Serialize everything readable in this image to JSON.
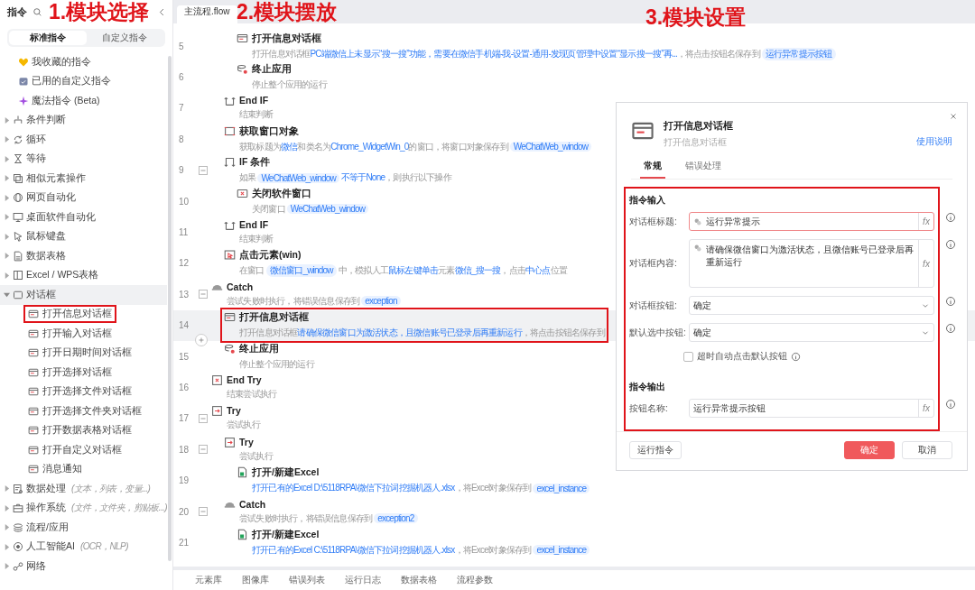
{
  "annotations": [
    {
      "text": "1.模块选择"
    },
    {
      "text": "2.模块摆放"
    },
    {
      "text": "3.模块设置"
    }
  ],
  "sidebar": {
    "title": "指令",
    "tabs": [
      {
        "label": "标准指令",
        "selected": true
      },
      {
        "label": "自定义指令",
        "selected": false
      }
    ],
    "items": [
      {
        "kind": "shortcut",
        "label": "我收藏的指令"
      },
      {
        "kind": "shortcut",
        "label": "已用的自定义指令"
      },
      {
        "kind": "shortcut",
        "label": "魔法指令 (Beta)"
      },
      {
        "kind": "category",
        "label": "条件判断",
        "expanded": false
      },
      {
        "kind": "category",
        "label": "循环",
        "expanded": false
      },
      {
        "kind": "category",
        "label": "等待",
        "expanded": false
      },
      {
        "kind": "category",
        "label": "相似元素操作",
        "expanded": false
      },
      {
        "kind": "category",
        "label": "网页自动化",
        "expanded": false
      },
      {
        "kind": "category",
        "label": "桌面软件自动化",
        "expanded": false
      },
      {
        "kind": "category",
        "label": "鼠标键盘",
        "expanded": false
      },
      {
        "kind": "category",
        "label": "数据表格",
        "expanded": false
      },
      {
        "kind": "category",
        "label": "Excel / WPS表格",
        "expanded": false
      },
      {
        "kind": "category",
        "label": "对话框",
        "expanded": true,
        "children": [
          {
            "label": "打开信息对话框",
            "highlighted": true
          },
          {
            "label": "打开输入对话框",
            "highlighted": false
          },
          {
            "label": "打开日期时间对话框",
            "highlighted": false
          },
          {
            "label": "打开选择对话框",
            "highlighted": false
          },
          {
            "label": "打开选择文件对话框",
            "highlighted": false
          },
          {
            "label": "打开选择文件夹对话框",
            "highlighted": false
          },
          {
            "label": "打开数据表格对话框",
            "highlighted": false
          },
          {
            "label": "打开自定义对话框",
            "highlighted": false
          },
          {
            "label": "消息通知",
            "highlighted": false
          }
        ]
      },
      {
        "kind": "category",
        "label": "数据处理",
        "hint": "(文本，列表，变量...)",
        "expanded": false
      },
      {
        "kind": "category",
        "label": "操作系统",
        "hint": "(文件，文件夹，剪贴板...)",
        "expanded": false
      },
      {
        "kind": "category",
        "label": "流程/应用",
        "expanded": false
      },
      {
        "kind": "category",
        "label": "人工智能AI",
        "hint": "(OCR，NLP)",
        "expanded": false
      },
      {
        "kind": "category",
        "label": "网络",
        "expanded": false
      }
    ]
  },
  "editor": {
    "tab": "主流程.flow"
  },
  "flow": {
    "items": [
      {
        "children": [
          {
            "children": [
              {
                "line": "5",
                "kind": "dialog",
                "title": "打开信息对话框",
                "selected": false,
                "highlighted": false,
                "desc": [
                  {
                    "kind": "text",
                    "text": "打开信息对话框"
                  },
                  {
                    "kind": "link",
                    "text": "PC端微信上未显示“搜一搜”功能，需要在微信手机端-我-设置-通用-发现页管理中设置“显示搜一搜”再..."
                  },
                  {
                    "kind": "text",
                    "text": "，将点击按钮名保存到"
                  },
                  {
                    "kind": "chip",
                    "text": "运行异常提示按钮"
                  }
                ]
              },
              {
                "line": "6",
                "kind": "stop",
                "title": "终止应用",
                "selected": false,
                "highlighted": false,
                "desc": [
                  {
                    "kind": "text",
                    "text": "停止整个应用的运行"
                  }
                ]
              }
            ]
          },
          {
            "line": "7",
            "kind": "endif",
            "title": "End IF",
            "selected": false,
            "highlighted": false,
            "desc": [
              {
                "kind": "text",
                "text": "结束判断"
              }
            ]
          },
          {
            "line": "8",
            "kind": "window",
            "title": "获取窗口对象",
            "selected": false,
            "highlighted": false,
            "desc": [
              {
                "kind": "text",
                "text": "获取标题为"
              },
              {
                "kind": "link",
                "text": "微信"
              },
              {
                "kind": "text",
                "text": "和类名为"
              },
              {
                "kind": "link",
                "text": "Chrome_WidgetWin_0"
              },
              {
                "kind": "text",
                "text": "的窗口，将窗口对象保存到"
              },
              {
                "kind": "chip",
                "text": "WeChatWeb_window"
              }
            ]
          },
          {
            "line": "9",
            "kind": "if",
            "title": "IF 条件",
            "selected": false,
            "highlighted": false,
            "expanded": true,
            "desc": [
              {
                "kind": "text",
                "text": "如果"
              },
              {
                "kind": "chip",
                "text": "WeChatWeb_window"
              },
              {
                "kind": "link",
                "text": "不等于None"
              },
              {
                "kind": "text",
                "text": "，则执行以下操作"
              }
            ],
            "children": [
              {
                "line": "10",
                "kind": "close-window",
                "title": "关闭软件窗口",
                "selected": false,
                "highlighted": false,
                "desc": [
                  {
                    "kind": "text",
                    "text": "关闭窗口"
                  },
                  {
                    "kind": "chip",
                    "text": "WeChatWeb_window"
                  }
                ]
              }
            ]
          },
          {
            "line": "11",
            "kind": "endif",
            "title": "End IF",
            "selected": false,
            "highlighted": false,
            "desc": [
              {
                "kind": "text",
                "text": "结束判断"
              }
            ]
          },
          {
            "line": "12",
            "kind": "click",
            "title": "点击元素(win)",
            "selected": false,
            "highlighted": false,
            "desc": [
              {
                "kind": "text",
                "text": "在窗口"
              },
              {
                "kind": "chip",
                "text": "微信窗口_window"
              },
              {
                "kind": "text",
                "text": "中，模拟人工"
              },
              {
                "kind": "link",
                "text": "鼠标左键单击"
              },
              {
                "kind": "text",
                "text": "元素"
              },
              {
                "kind": "link",
                "text": "微信_搜一搜"
              },
              {
                "kind": "text",
                "text": "，点击"
              },
              {
                "kind": "link",
                "text": "中心点"
              },
              {
                "kind": "text",
                "text": "位置"
              }
            ]
          }
        ]
      },
      {
        "line": "13",
        "kind": "catch",
        "title": "Catch",
        "selected": false,
        "highlighted": false,
        "expanded": true,
        "desc": [
          {
            "kind": "text",
            "text": "尝试失败时执行，将错误信息保存到"
          },
          {
            "kind": "chip",
            "text": "exception"
          }
        ],
        "children": [
          {
            "line": "14",
            "kind": "dialog",
            "title": "打开信息对话框",
            "selected": true,
            "highlighted": true,
            "desc": [
              {
                "kind": "text",
                "text": "打开信息对话框"
              },
              {
                "kind": "link",
                "text": "请确保微信窗口为激活状态，且微信账号已登录后再重新运行"
              },
              {
                "kind": "text",
                "text": "，将点击按钮名保存到"
              }
            ]
          },
          {
            "line": "15",
            "kind": "stop",
            "title": "终止应用",
            "selected": false,
            "highlighted": false,
            "desc": [
              {
                "kind": "text",
                "text": "停止整个应用的运行"
              }
            ]
          }
        ]
      },
      {
        "line": "16",
        "kind": "endtry",
        "title": "End Try",
        "selected": false,
        "highlighted": false,
        "desc": [
          {
            "kind": "text",
            "text": "结束尝试执行"
          }
        ]
      },
      {
        "line": "17",
        "kind": "try",
        "title": "Try",
        "selected": false,
        "highlighted": false,
        "expanded": true,
        "desc": [
          {
            "kind": "text",
            "text": "尝试执行"
          }
        ],
        "children": [
          {
            "line": "18",
            "kind": "try",
            "title": "Try",
            "selected": false,
            "highlighted": false,
            "expanded": true,
            "desc": [
              {
                "kind": "text",
                "text": "尝试执行"
              }
            ],
            "children": [
              {
                "line": "19",
                "kind": "excel",
                "title": "打开/新建Excel",
                "selected": false,
                "highlighted": false,
                "desc": [
                  {
                    "kind": "link",
                    "text": "打开已有的Excel D:\\5118RPA\\微信下拉词挖掘机器人.xlsx"
                  },
                  {
                    "kind": "text",
                    "text": "，将Excel对象保存到"
                  },
                  {
                    "kind": "chip",
                    "text": "excel_instance"
                  }
                ]
              }
            ]
          },
          {
            "line": "20",
            "kind": "catch",
            "title": "Catch",
            "selected": false,
            "highlighted": false,
            "expanded": true,
            "desc": [
              {
                "kind": "text",
                "text": "尝试失败时执行，将错误信息保存到"
              },
              {
                "kind": "chip",
                "text": "exception2"
              }
            ],
            "children": [
              {
                "line": "21",
                "kind": "excel",
                "title": "打开/新建Excel",
                "selected": false,
                "highlighted": false,
                "desc": [
                  {
                    "kind": "link",
                    "text": "打开已有的Excel C:\\5118RPA\\微信下拉词挖掘机器人.xlsx"
                  },
                  {
                    "kind": "text",
                    "text": "，将Excel对象保存到"
                  },
                  {
                    "kind": "chip",
                    "text": "excel_instance"
                  }
                ]
              }
            ]
          }
        ]
      }
    ]
  },
  "bottom_tabs": [
    "元素库",
    "图像库",
    "错误列表",
    "运行日志",
    "数据表格",
    "流程参数"
  ],
  "dialog": {
    "title": "打开信息对话框",
    "subtitle": "打开信息对话框",
    "help_link": "使用说明",
    "highlighted": true,
    "tabs": [
      {
        "label": "常规",
        "selected": true
      },
      {
        "label": "错误处理",
        "selected": false
      }
    ],
    "sections": [
      {
        "title": "指令输入",
        "fields": [
          {
            "kind": "text",
            "label": "对话框标题:",
            "value": "运行异常提示",
            "variable": true,
            "focused": true,
            "formula": "fx"
          },
          {
            "kind": "textarea",
            "label": "对话框内容:",
            "value": "请确保微信窗口为激活状态，且微信账号已登录后再重新运行",
            "variable": true,
            "focused": false,
            "formula": "fx"
          },
          {
            "kind": "select",
            "label": "对话框按钮:",
            "value": "确定"
          },
          {
            "kind": "select",
            "label": "默认选中按钮:",
            "value": "确定"
          },
          {
            "kind": "checkbox",
            "label": "超时自动点击默认按钮",
            "checked": false
          }
        ]
      },
      {
        "title": "指令输出",
        "fields": [
          {
            "kind": "text",
            "label": "按钮名称:",
            "value": "运行异常提示按钮",
            "variable": false,
            "focused": false,
            "formula": "fx"
          }
        ]
      }
    ],
    "buttons": [
      {
        "label": "运行指令",
        "kind": "default"
      },
      {
        "label": "确定",
        "kind": "primary"
      },
      {
        "label": "取消",
        "kind": "default"
      }
    ]
  }
}
